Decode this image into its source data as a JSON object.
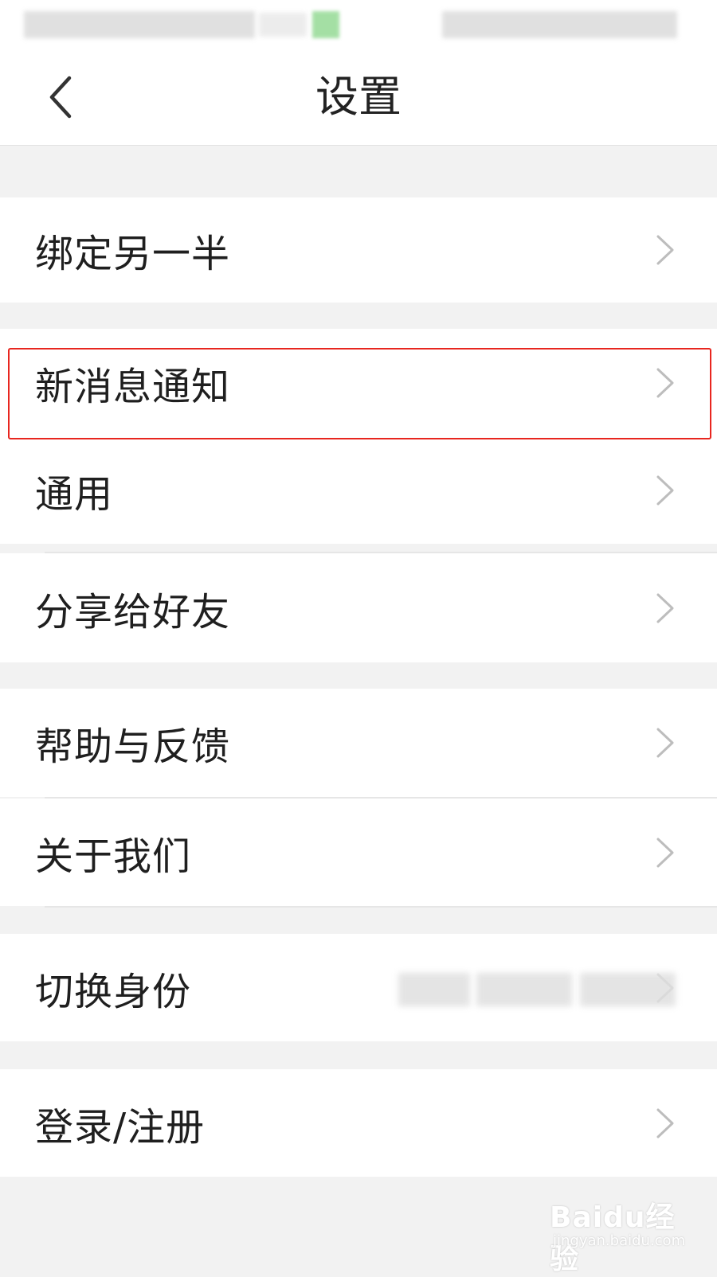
{
  "nav": {
    "title": "设置",
    "back_icon": "chevron-left-icon"
  },
  "settings": {
    "bind_partner": "绑定另一半",
    "new_message_notification": "新消息通知",
    "general": "通用",
    "share_to_friends": "分享给好友",
    "help_feedback": "帮助与反馈",
    "about_us": "关于我们",
    "switch_identity": "切换身份",
    "login_register": "登录/注册"
  },
  "row_chevron_icon": "chevron-right-icon",
  "highlight": {
    "target": "新消息通知",
    "color": "#e8261f"
  },
  "watermark": {
    "main": "Baidu经验",
    "sub": "jingyan.baidu.com"
  },
  "colors": {
    "page_background": "#f2f2f2",
    "row_background": "#ffffff",
    "text": "#1f1f1f",
    "chevron": "#bdbdbd"
  }
}
